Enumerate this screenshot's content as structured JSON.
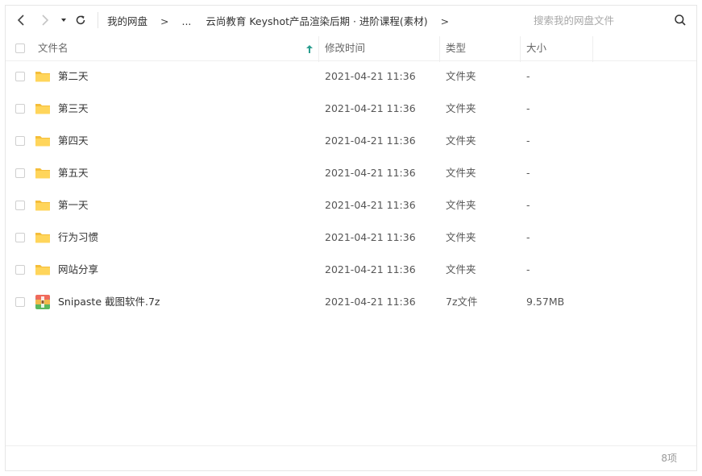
{
  "toolbar": {
    "breadcrumb": [
      "我的网盘",
      "...",
      "云尚教育 Keyshot产品渲染后期 · 进阶课程(素材)"
    ],
    "crumb_separator": ">",
    "search_placeholder": "搜索我的网盘文件"
  },
  "columns": {
    "name": "文件名",
    "modified": "修改时间",
    "type": "类型",
    "size": "大小"
  },
  "files": [
    {
      "name": "第二天",
      "modified": "2021-04-21 11:36",
      "type": "文件夹",
      "size": "-",
      "icon": "folder-icon"
    },
    {
      "name": "第三天",
      "modified": "2021-04-21 11:36",
      "type": "文件夹",
      "size": "-",
      "icon": "folder-icon"
    },
    {
      "name": "第四天",
      "modified": "2021-04-21 11:36",
      "type": "文件夹",
      "size": "-",
      "icon": "folder-icon"
    },
    {
      "name": "第五天",
      "modified": "2021-04-21 11:36",
      "type": "文件夹",
      "size": "-",
      "icon": "folder-icon"
    },
    {
      "name": "第一天",
      "modified": "2021-04-21 11:36",
      "type": "文件夹",
      "size": "-",
      "icon": "folder-icon"
    },
    {
      "name": "行为习惯",
      "modified": "2021-04-21 11:36",
      "type": "文件夹",
      "size": "-",
      "icon": "folder-icon"
    },
    {
      "name": "网站分享",
      "modified": "2021-04-21 11:36",
      "type": "文件夹",
      "size": "-",
      "icon": "folder-icon"
    },
    {
      "name": "Snipaste 截图软件.7z",
      "modified": "2021-04-21 11:36",
      "type": "7z文件",
      "size": "9.57MB",
      "icon": "archive-icon"
    }
  ],
  "status": {
    "count": "8项"
  },
  "colors": {
    "folder": "#FFD55B",
    "folder_back": "#F5BE3A",
    "sort_arrow": "#2a9d8f"
  }
}
